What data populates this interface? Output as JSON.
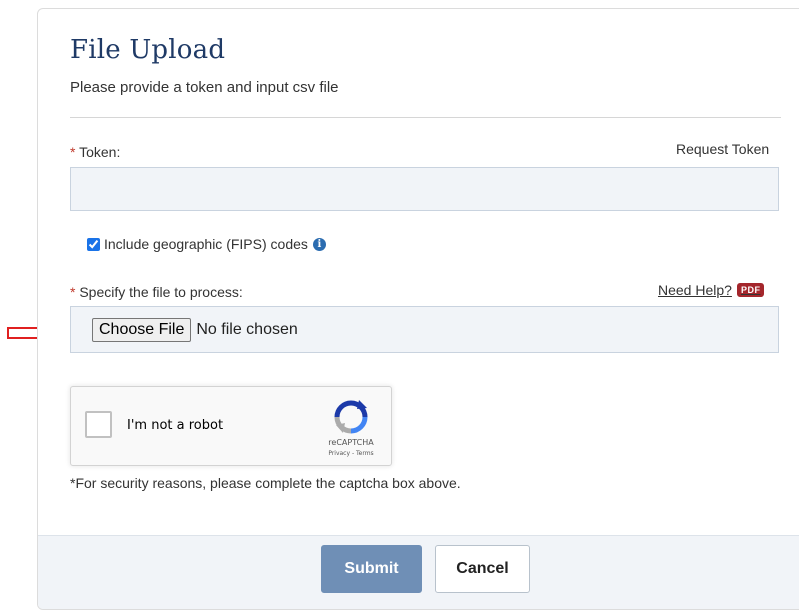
{
  "header": {
    "title": "File Upload",
    "subtitle": "Please provide a token and input csv file"
  },
  "token": {
    "required_mark": "*",
    "label": "Token:",
    "request_link": "Request Token",
    "value": "",
    "placeholder": ""
  },
  "fips": {
    "checked": true,
    "label": "Include geographic (FIPS) codes",
    "info_icon": "info-circle-icon",
    "info_glyph": "i"
  },
  "file": {
    "required_mark": "*",
    "label": "Specify the file to process:",
    "need_help": "Need Help?",
    "pdf_badge": "PDF",
    "choose_button": "Choose File",
    "status": "No file chosen"
  },
  "captcha": {
    "label": "I'm not a robot",
    "brand": "reCAPTCHA",
    "links": "Privacy - Terms",
    "icon": "recaptcha-logo-icon"
  },
  "security_note": "*For security reasons, please complete the captcha box above.",
  "footer": {
    "submit": "Submit",
    "cancel": "Cancel"
  },
  "colors": {
    "title": "#1f3a66",
    "required": "#c0392b",
    "pdf_badge": "#a4262c",
    "submit_bg": "#6f8fb6",
    "arrow": "#e02020",
    "field_bg": "#f1f4f8"
  }
}
